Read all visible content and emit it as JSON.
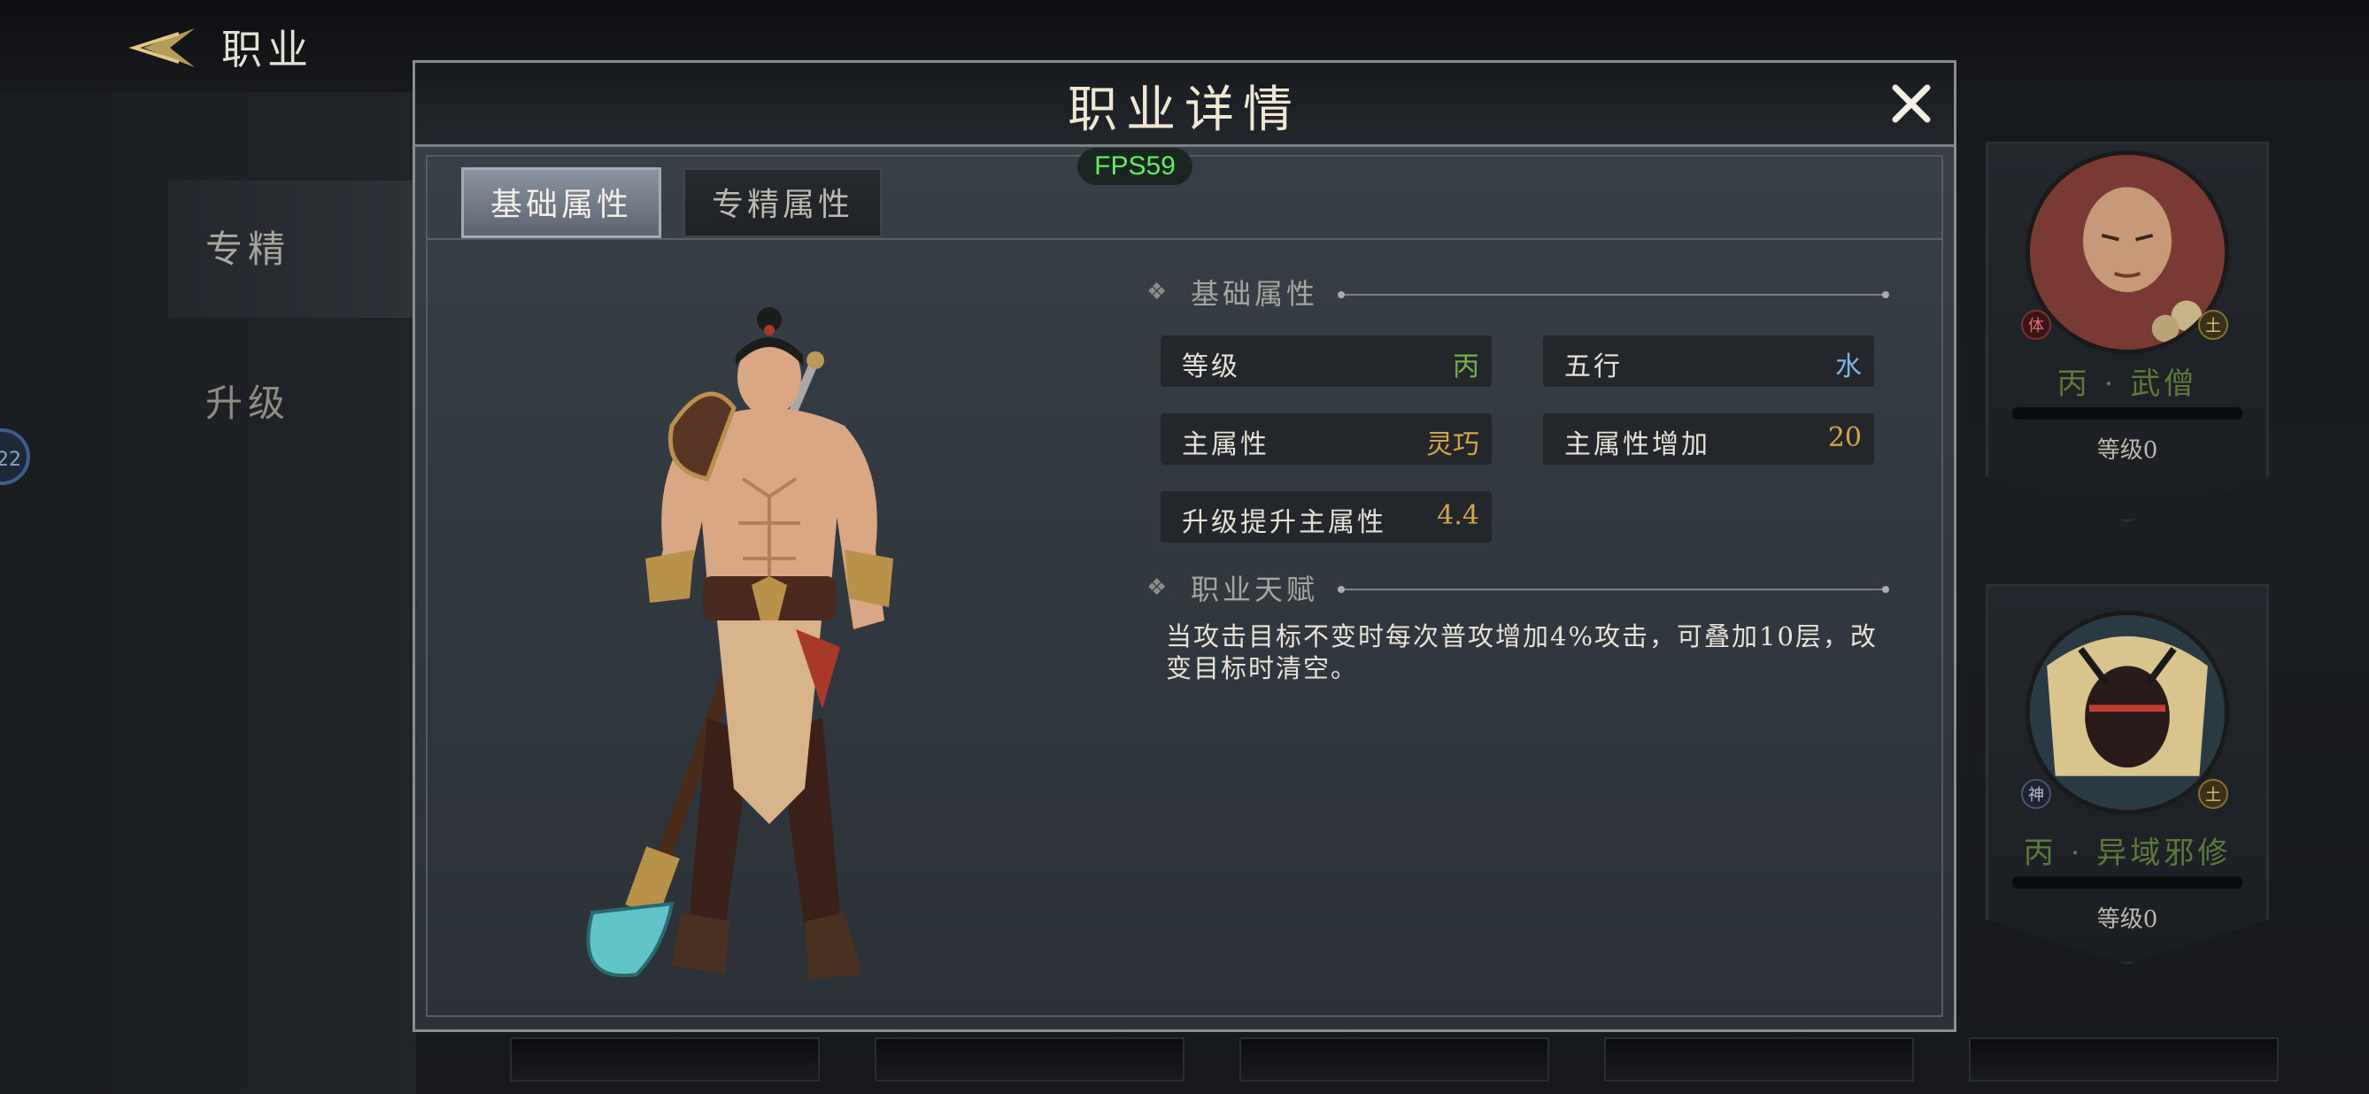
{
  "header": {
    "title": "职业"
  },
  "sidebar": {
    "items": [
      {
        "label": "专精"
      },
      {
        "label": "升级"
      }
    ],
    "badge": "22"
  },
  "cards": [
    {
      "name": "丙 · 武僧",
      "level": "等级0",
      "badge_left": "体",
      "badge_right": "土"
    },
    {
      "name": "丙 · 异域邪修",
      "level": "等级0",
      "badge_left": "神",
      "badge_right": "土"
    }
  ],
  "modal": {
    "title": "职业详情",
    "fps": "FPS59",
    "tabs": [
      {
        "label": "基础属性"
      },
      {
        "label": "专精属性"
      }
    ],
    "basic_section": {
      "title": "基础属性"
    },
    "stats": {
      "grade": {
        "label": "等级",
        "value": "丙"
      },
      "element": {
        "label": "五行",
        "value": "水"
      },
      "main_attr": {
        "label": "主属性",
        "value": "灵巧"
      },
      "main_attr_bonus": {
        "label": "主属性增加",
        "value": "20"
      },
      "levelup_gain": {
        "label": "升级提升主属性",
        "value": "4.4"
      }
    },
    "talent_section": {
      "title": "职业天赋"
    },
    "talent_text": "当攻击目标不变时每次普攻增加4%攻击，可叠加10层，改变目标时清空。"
  },
  "colors": {
    "grade_green": "#76b04e",
    "water_blue": "#7ab6e8",
    "value_gold": "#d4a44a",
    "fps_green": "#5ff05f"
  }
}
